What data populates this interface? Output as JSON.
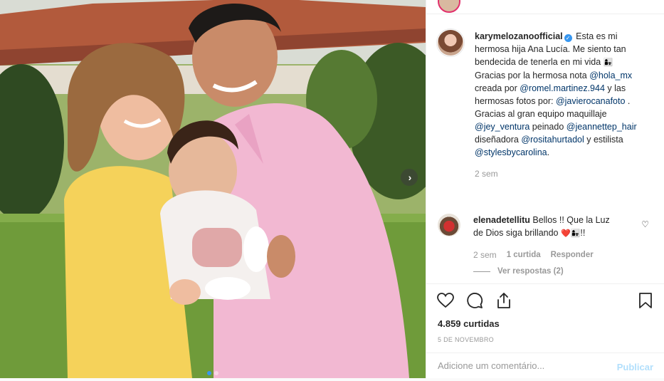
{
  "post": {
    "author": {
      "username": "karymelozanoofficial",
      "verified": true
    },
    "caption": {
      "t1": " Esta es mi hermosa hija Ana Lucía. Me siento tan bendecida de tenerla en mi vida ",
      "emoji1": "👩‍👧",
      "t2": " Gracias por la hermosa nota ",
      "m1": "@hola_mx",
      "t3": " creada por ",
      "m2": "@romel.martinez.944",
      "t4": " y las hermosas fotos por: ",
      "m3": "@javierocanafoto",
      "t5": " . Gracias al gran equipo maquillaje ",
      "m4": "@jey_ventura",
      "t6": " peinado ",
      "m5": "@jeannettep_hair",
      "t7": " diseñadora ",
      "m6": "@rositahurtadol",
      "t8": " y estilista ",
      "m7": "@stylesbycarolina",
      "t9": "."
    },
    "caption_time": "2 sem"
  },
  "comment": {
    "username": "elenadetellitu",
    "text": " Bellos !! Que la Luz",
    "text2": "​de Dios siga brillando ",
    "emoji": "❤️👩‍👧",
    "text3": "!!",
    "time": "2 sem",
    "likes": "1 curtida",
    "reply": "Responder",
    "view_replies": "Ver respostas (2)"
  },
  "actions": {
    "likes_count": "4.859 curtidas",
    "date": "5 DE NOVEMBRO",
    "comment_placeholder": "Adicione um comentário...",
    "publish": "Publicar"
  },
  "icons": {
    "like": "heart-icon",
    "comment": "comment-bubble-icon",
    "share": "share-icon",
    "save": "bookmark-icon",
    "next": "chevron-right-icon"
  },
  "carousel": {
    "slides": 2,
    "active_slide": 1
  },
  "colors": {
    "accent": "#3897f0",
    "link": "#003569",
    "muted": "#999999",
    "publish_disabled": "#b2dffc"
  }
}
